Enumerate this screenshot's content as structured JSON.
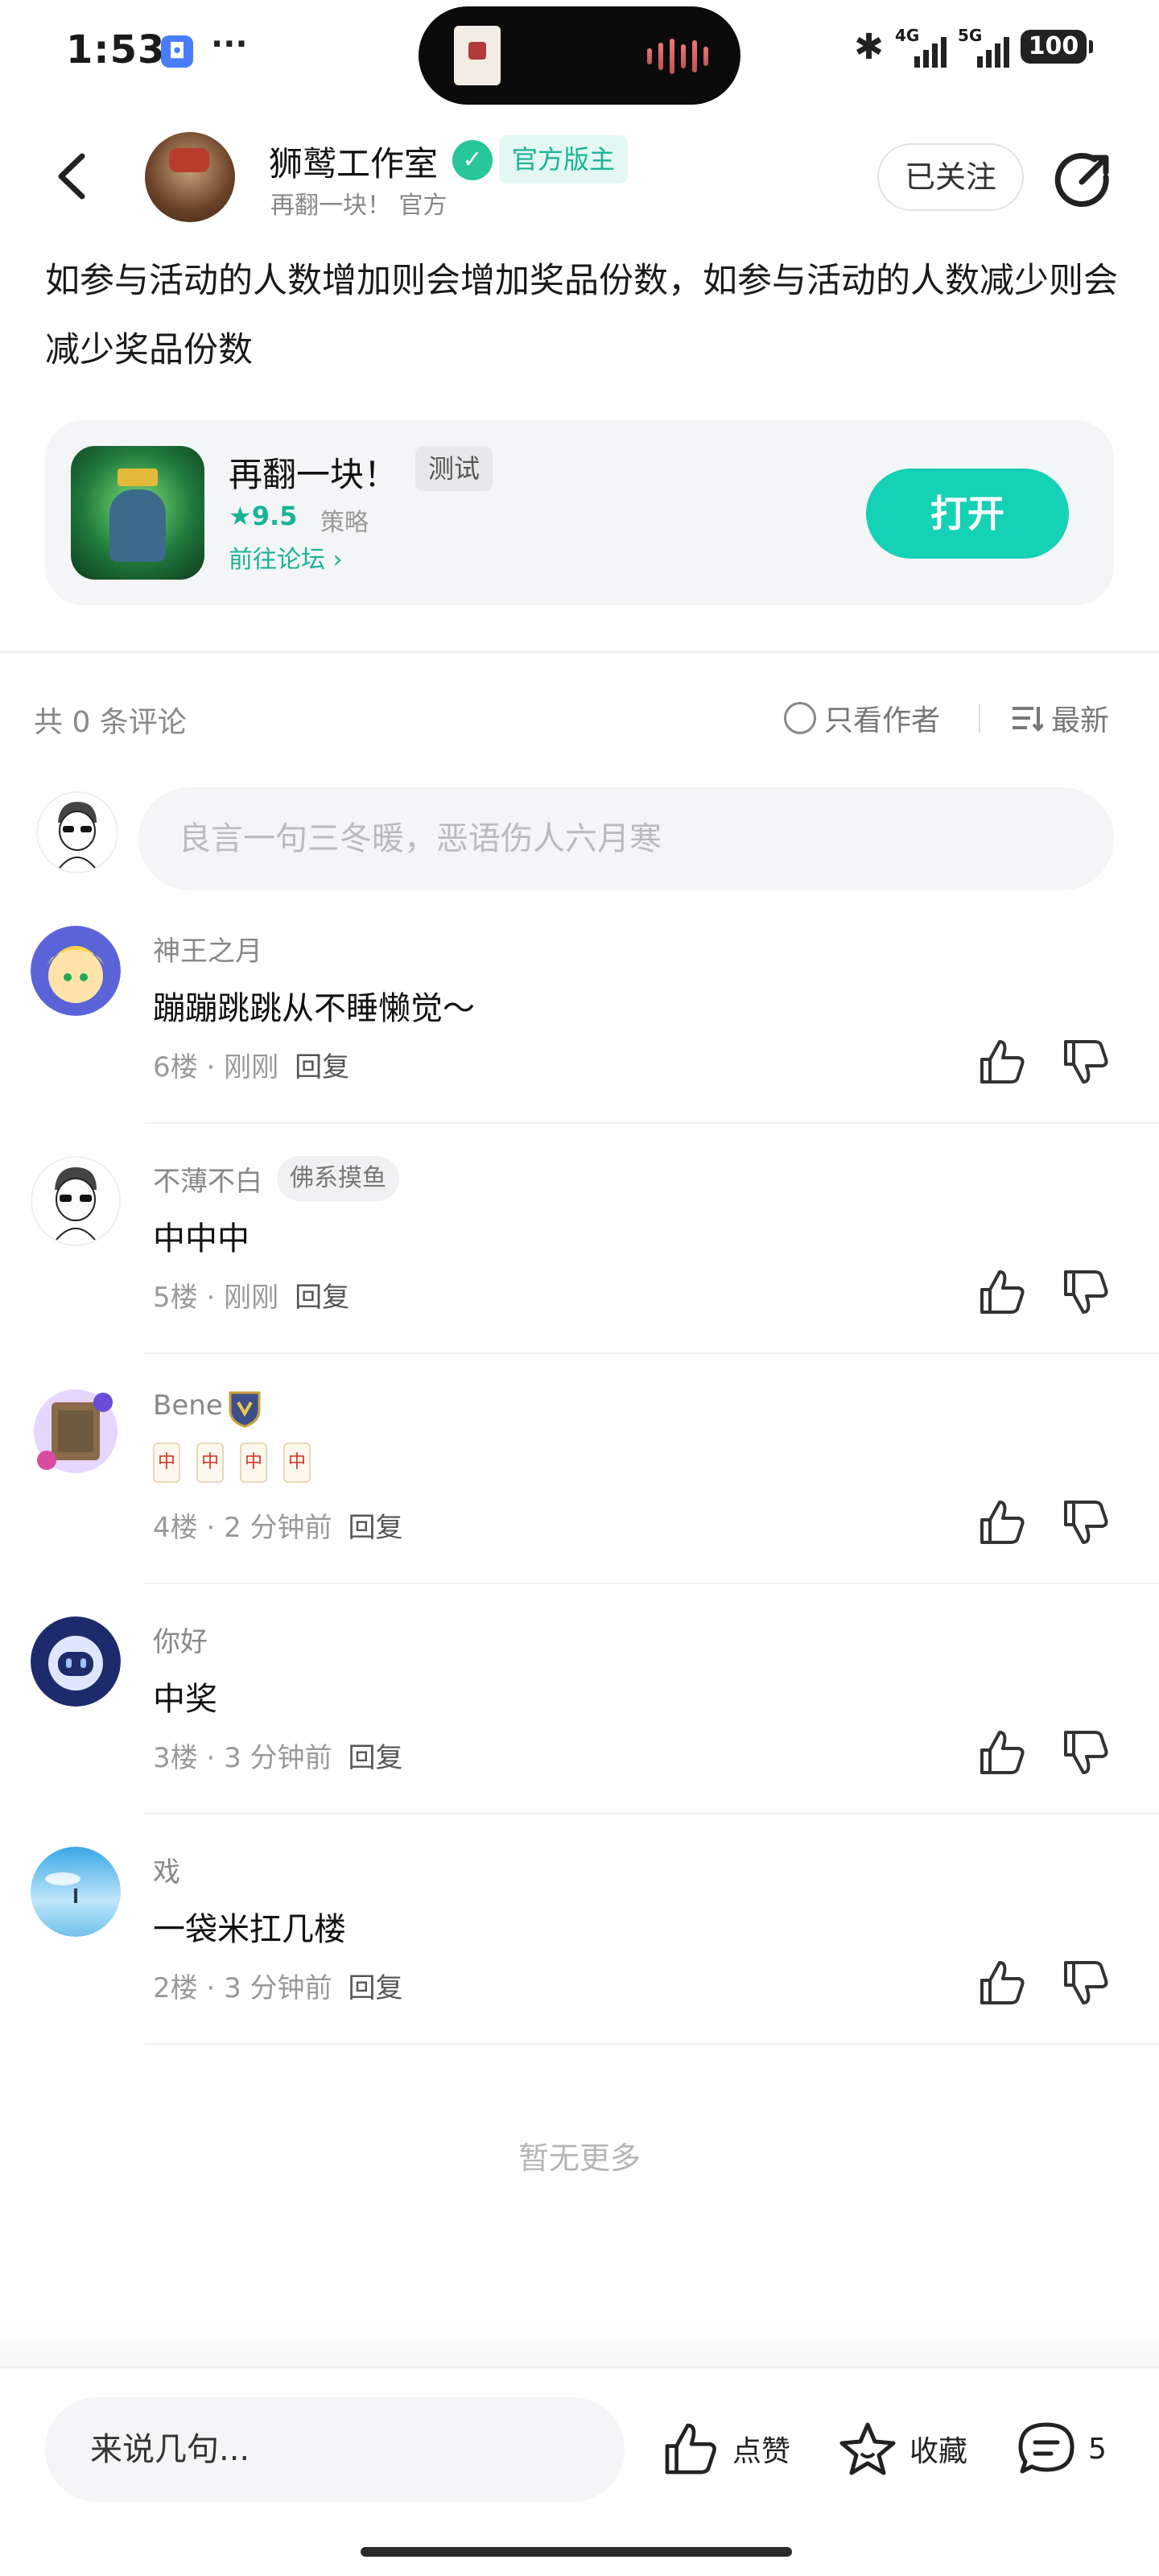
{
  "status_bar": {
    "time": "1:53",
    "more": "···",
    "net1": "4G",
    "net2": "5G",
    "battery": "100"
  },
  "header": {
    "author_name": "狮鹫工作室",
    "author_badge": "官方版主",
    "author_sub": "再翻一块！ 官方",
    "follow_label": "已关注"
  },
  "post": {
    "text": "如参与活动的人数增加则会增加奖品份数，如参与活动的人数减少则会减少奖品份数"
  },
  "game_card": {
    "name": "再翻一块！",
    "tag": "测试",
    "rating": "9.5",
    "genre": "策略",
    "forum_link": "前往论坛",
    "open_label": "打开"
  },
  "comments_header": {
    "count_text": "共 0 条评论",
    "author_only": "只看作者",
    "sort": "最新"
  },
  "comment_input": {
    "placeholder": "良言一句三冬暖，恶语伤人六月寒"
  },
  "comments": [
    {
      "name": "神王之月",
      "tag": "",
      "text": "蹦蹦跳跳从不睡懒觉～",
      "floor": "6楼",
      "time": "刚刚",
      "reply": "回复"
    },
    {
      "name": "不薄不白",
      "tag": "佛系摸鱼",
      "text": "中中中",
      "floor": "5楼",
      "time": "刚刚",
      "reply": "回复"
    },
    {
      "name": "Bene",
      "tag": "",
      "text": "🀄🀄🀄🀄",
      "floor": "4楼",
      "time": "2 分钟前",
      "reply": "回复"
    },
    {
      "name": "你好",
      "tag": "",
      "text": "中奖",
      "floor": "3楼",
      "time": "3 分钟前",
      "reply": "回复"
    },
    {
      "name": "戏",
      "tag": "",
      "text": "一袋米扛几楼",
      "floor": "2楼",
      "time": "3 分钟前",
      "reply": "回复"
    }
  ],
  "footer": {
    "no_more": "暂无更多"
  },
  "bottom_bar": {
    "input_placeholder": "来说几句...",
    "like_label": "点赞",
    "fav_label": "收藏",
    "comment_count": "5"
  },
  "colors": {
    "accent": "#15d1b5",
    "accent_text": "#19b394",
    "badge_bg": "#e3f8f3"
  }
}
